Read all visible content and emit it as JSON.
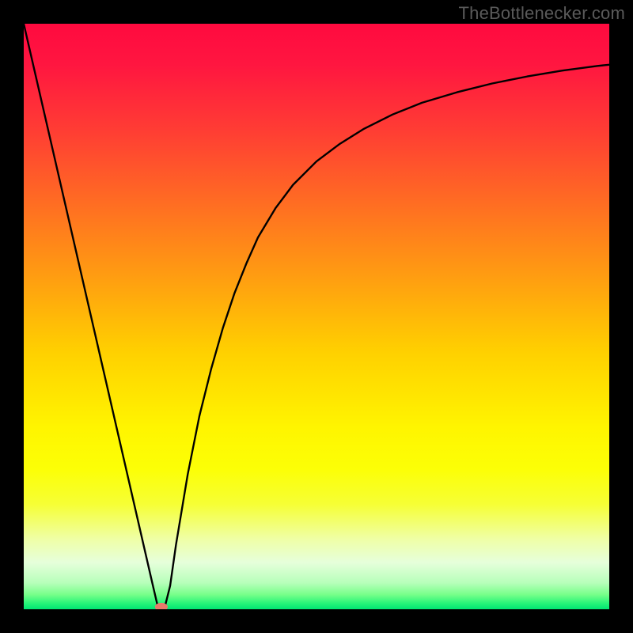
{
  "watermark": "TheBottlenecker.com",
  "chart_data": {
    "type": "line",
    "title": "",
    "xlabel": "",
    "ylabel": "",
    "xlim": [
      0,
      100
    ],
    "ylim": [
      0,
      100
    ],
    "gradient_stops": [
      {
        "offset": 0.0,
        "color": "#ff0a3f"
      },
      {
        "offset": 0.07,
        "color": "#ff1640"
      },
      {
        "offset": 0.18,
        "color": "#ff3c34"
      },
      {
        "offset": 0.31,
        "color": "#ff6e22"
      },
      {
        "offset": 0.44,
        "color": "#ffa010"
      },
      {
        "offset": 0.56,
        "color": "#ffd000"
      },
      {
        "offset": 0.69,
        "color": "#fff500"
      },
      {
        "offset": 0.76,
        "color": "#fcff06"
      },
      {
        "offset": 0.82,
        "color": "#f6ff34"
      },
      {
        "offset": 0.88,
        "color": "#efffa6"
      },
      {
        "offset": 0.92,
        "color": "#e6ffdb"
      },
      {
        "offset": 0.955,
        "color": "#b7ffba"
      },
      {
        "offset": 0.975,
        "color": "#77ff8a"
      },
      {
        "offset": 0.99,
        "color": "#26f578"
      },
      {
        "offset": 1.0,
        "color": "#00e673"
      }
    ],
    "curve": {
      "x": [
        0.0,
        2.0,
        4.0,
        6.0,
        8.0,
        10.0,
        12.0,
        14.0,
        16.0,
        18.0,
        20.0,
        22.0,
        23.0,
        24.0,
        25.0,
        26.0,
        28.0,
        30.0,
        32.0,
        34.0,
        36.0,
        38.0,
        40.0,
        43.0,
        46.0,
        50.0,
        54.0,
        58.0,
        63.0,
        68.0,
        74.0,
        80.0,
        86.0,
        92.0,
        98.0,
        100.0
      ],
      "y": [
        100.0,
        91.3,
        82.6,
        73.9,
        65.2,
        56.5,
        47.8,
        39.1,
        30.4,
        21.7,
        13.0,
        4.3,
        0.0,
        0.0,
        4.0,
        11.0,
        23.0,
        33.0,
        41.0,
        48.0,
        54.0,
        59.0,
        63.5,
        68.5,
        72.5,
        76.5,
        79.5,
        82.0,
        84.5,
        86.5,
        88.3,
        89.8,
        91.0,
        92.0,
        92.8,
        93.0
      ]
    },
    "marker": {
      "cx": 23.5,
      "cy": 0.4,
      "r": 0.9,
      "fill": "#e87a6a"
    }
  }
}
